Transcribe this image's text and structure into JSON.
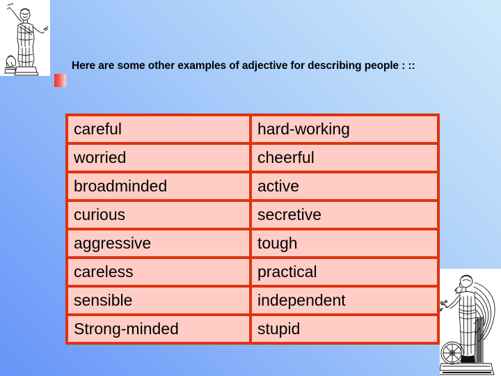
{
  "slide": {
    "background_top_color": "#CFE9FB",
    "background_bottom_color": "#6695F8",
    "heading": "Here are some other examples of adjective for describing people : ::",
    "bullet_color": "#E8352A"
  },
  "table": {
    "border_color": "#DD3311",
    "cell_color": "#FFCDC5",
    "rows": [
      {
        "left": "careful",
        "right": "hard-working"
      },
      {
        "left": "worried",
        "right": "cheerful"
      },
      {
        "left": "broadminded",
        "right": "active"
      },
      {
        "left": "curious",
        "right": "secretive"
      },
      {
        "left": "aggressive",
        "right": "tough"
      },
      {
        "left": "careless",
        "right": "practical"
      },
      {
        "left": "sensible",
        "right": "independent"
      },
      {
        "left": "Strong-minded",
        "right": "stupid"
      }
    ]
  },
  "decorations": {
    "top_left": "classical-statue-engraving",
    "bottom_right": "winged-angel-engraving"
  }
}
